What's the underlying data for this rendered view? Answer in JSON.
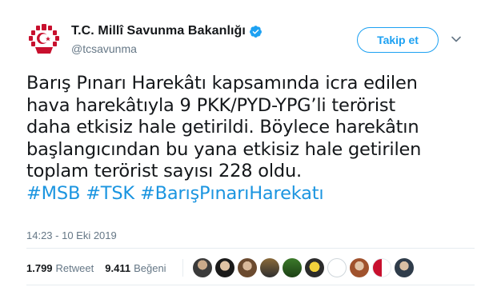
{
  "account": {
    "display_name": "T.C. Millî Savunma Bakanlığı",
    "handle": "@tcsavunma",
    "verified": true,
    "avatar_icon": "turkish-flag-emblem-icon"
  },
  "actions": {
    "follow_label": "Takip et",
    "menu_icon": "chevron-down-icon"
  },
  "tweet": {
    "lines": [
      "Barış Pınarı Harekâtı kapsamında icra edilen",
      "hava harekâtıyla 9 PKK/PYD-YPG’li terörist",
      "daha etkisiz hale getirildi. Böylece harekâtın",
      "başlangıcından bu yana etkisiz hale getirilen",
      "toplam terörist sayısı 228 oldu."
    ],
    "hashtags": [
      "#MSB",
      "#TSK",
      "#BarışPınarıHarekatı"
    ],
    "timestamp": "14:23 - 10 Eki 2019"
  },
  "stats": {
    "retweet_count": "1.799",
    "retweet_label": "Retweet",
    "like_count": "9.411",
    "like_label": "Beğeni"
  },
  "colors": {
    "accent": "#1da1f2",
    "hashtag": "#1b95e0",
    "secondary_text": "#657786",
    "border": "#e6ecf0",
    "flag_red": "#c8102e"
  }
}
